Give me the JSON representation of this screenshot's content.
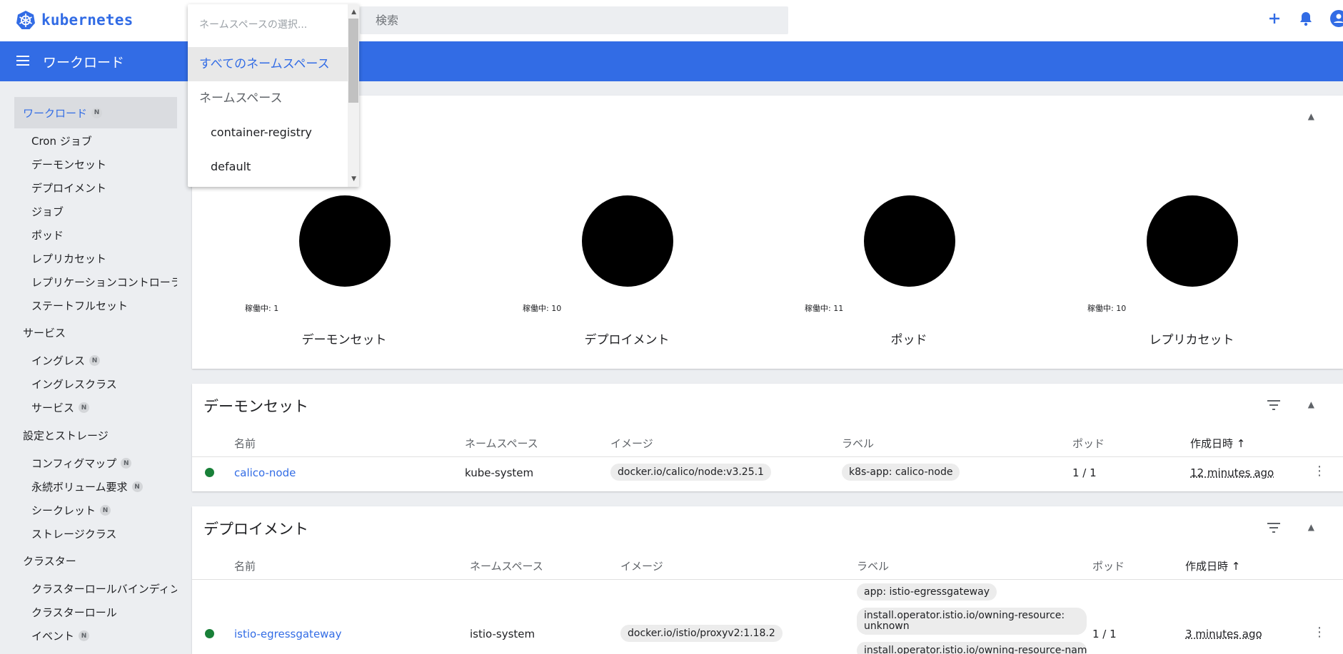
{
  "header": {
    "logo_text": "kubernetes",
    "search_placeholder": "検索"
  },
  "titlebar": {
    "title": "ワークロード"
  },
  "namespace_dropdown": {
    "placeholder": "ネームスペースの選択...",
    "options": [
      {
        "label": "すべてのネームスペース",
        "selected": true
      },
      {
        "label": "ネームスペース",
        "group": true
      },
      {
        "label": "container-registry"
      },
      {
        "label": "default"
      }
    ]
  },
  "sidebar": {
    "workloads": "ワークロード",
    "workloads_badge": "N",
    "workload_items": [
      "Cron ジョブ",
      "デーモンセット",
      "デプロイメント",
      "ジョブ",
      "ポッド",
      "レプリカセット",
      "レプリケーションコントローラー",
      "ステートフルセット"
    ],
    "services_group": "サービス",
    "service_items": [
      {
        "label": "イングレス",
        "badge": "N"
      },
      {
        "label": "イングレスクラス"
      },
      {
        "label": "サービス",
        "badge": "N"
      }
    ],
    "config_group": "設定とストレージ",
    "config_items": [
      {
        "label": "コンフィグマップ",
        "badge": "N"
      },
      {
        "label": "永続ボリューム要求",
        "badge": "N"
      },
      {
        "label": "シークレット",
        "badge": "N"
      },
      {
        "label": "ストレージクラス"
      }
    ],
    "cluster_group": "クラスター",
    "cluster_items": [
      {
        "label": "クラスターロールバインディング"
      },
      {
        "label": "クラスターロール"
      },
      {
        "label": "イベント",
        "badge": "N"
      }
    ]
  },
  "status_card": {
    "stats": [
      {
        "count": "稼働中: 1",
        "label": "デーモンセット"
      },
      {
        "count": "稼働中: 10",
        "label": "デプロイメント"
      },
      {
        "count": "稼働中: 11",
        "label": "ポッド"
      },
      {
        "count": "稼働中: 10",
        "label": "レプリカセット"
      }
    ]
  },
  "daemonsets_card": {
    "title": "デーモンセット",
    "columns": [
      "名前",
      "ネームスペース",
      "イメージ",
      "ラベル",
      "ポッド",
      "作成日時"
    ],
    "sort_arrow": "↑",
    "rows": [
      {
        "name": "calico-node",
        "namespace": "kube-system",
        "image": "docker.io/calico/node:v3.25.1",
        "labels": [
          "k8s-app: calico-node"
        ],
        "pods": "1 / 1",
        "created": "12 minutes ago"
      }
    ]
  },
  "deployments_card": {
    "title": "デプロイメント",
    "columns": [
      "名前",
      "ネームスペース",
      "イメージ",
      "ラベル",
      "ポッド",
      "作成日時"
    ],
    "sort_arrow": "↑",
    "rows": [
      {
        "name": "istio-egressgateway",
        "namespace": "istio-system",
        "image": "docker.io/istio/proxyv2:1.18.2",
        "labels": [
          "app: istio-egressgateway",
          "install.operator.istio.io/owning-resource: unknown",
          "install.operator.istio.io/owning-resource-namesp"
        ],
        "pods": "1 / 1",
        "created": "3 minutes ago"
      }
    ]
  },
  "colors": {
    "accent": "#326ce5",
    "status_ok": "#188038"
  }
}
